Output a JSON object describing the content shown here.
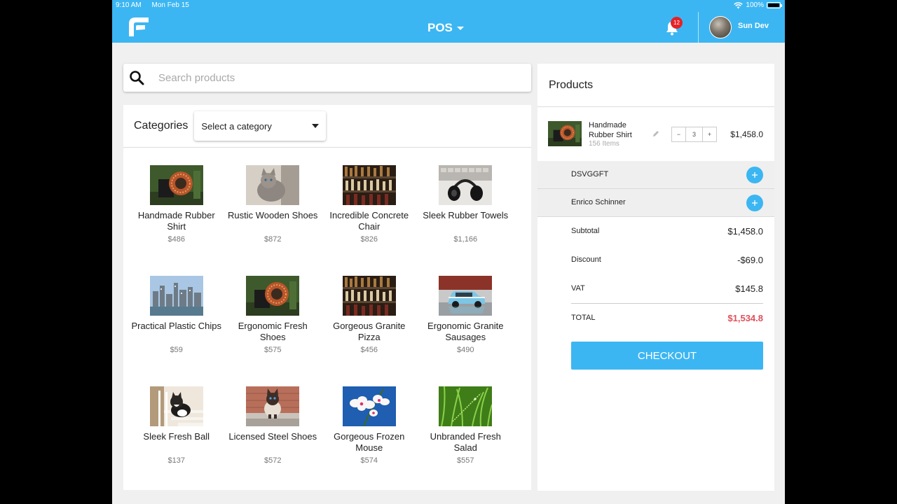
{
  "status_bar": {
    "time": "9:10 AM",
    "date": "Mon Feb 15",
    "battery": "100%"
  },
  "header": {
    "title": "POS",
    "notification_count": "12",
    "user_name": "Sun Dev"
  },
  "search": {
    "placeholder": "Search products"
  },
  "categories": {
    "label": "Categories",
    "selected": "Select a category"
  },
  "products": [
    {
      "name": "Handmade Rubber Shirt",
      "price": "$486",
      "image": "copper-coil"
    },
    {
      "name": "Rustic Wooden Shoes",
      "price": "$872",
      "image": "cat"
    },
    {
      "name": "Incredible Concrete Chair",
      "price": "$826",
      "image": "bottles"
    },
    {
      "name": "Sleek Rubber Towels",
      "price": "$1,166",
      "image": "headphones"
    },
    {
      "name": "Practical Plastic Chips",
      "price": "$59",
      "image": "city"
    },
    {
      "name": "Ergonomic Fresh Shoes",
      "price": "$575",
      "image": "copper-coil"
    },
    {
      "name": "Gorgeous Granite Pizza",
      "price": "$456",
      "image": "bottles"
    },
    {
      "name": "Ergonomic Granite Sausages",
      "price": "$490",
      "image": "car"
    },
    {
      "name": "Sleek Fresh Ball",
      "price": "$137",
      "image": "cat-stairs"
    },
    {
      "name": "Licensed Steel Shoes",
      "price": "$572",
      "image": "siamese-cat"
    },
    {
      "name": "Gorgeous Frozen Mouse",
      "price": "$574",
      "image": "orchid"
    },
    {
      "name": "Unbranded Fresh Salad",
      "price": "$557",
      "image": "grass"
    }
  ],
  "cart": {
    "title": "Products",
    "item": {
      "name": "Handmade Rubber Shirt",
      "sub": "156 Items",
      "qty": "3",
      "minus": "−",
      "plus": "+",
      "price": "$1,458.0"
    },
    "customers": [
      {
        "label": "DSVGGFT"
      },
      {
        "label": "Enrico Schinner"
      }
    ],
    "subtotal_label": "Subtotal",
    "subtotal": "$1,458.0",
    "discount_label": "Discount",
    "discount": "-$69.0",
    "vat_label": "VAT",
    "vat": "$145.8",
    "total_label": "TOTAL",
    "total": "$1,534.8",
    "checkout": "CHECKOUT"
  },
  "colors": {
    "accent": "#3cb6f2",
    "badge": "#e52227",
    "total": "#e0505a"
  }
}
